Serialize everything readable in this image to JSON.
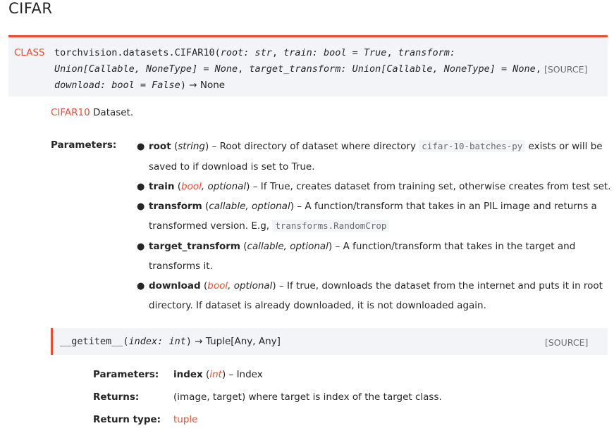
{
  "title": "CIFAR",
  "signature": {
    "class_kw": "CLASS",
    "name": "torchvision.datasets.CIFAR10",
    "open": "(",
    "p1": "root: str",
    "p2": "train: bool = True",
    "p3": "transform:",
    "p3b": "Union[Callable, NoneType] = None",
    "p4": "target_transform: Union[Callable, NoneType] = None",
    "p5": "download: bool = False",
    "close": ")",
    "arrow": "→",
    "ret": "None",
    "source": "[SOURCE]"
  },
  "description": {
    "link": "CIFAR10",
    "text": " Dataset."
  },
  "params_label": "Parameters:",
  "params": [
    {
      "name": "root",
      "type": "string",
      "sep": " – ",
      "desc_a": "Root directory of dataset where directory ",
      "code": "cifar-10-batches-py",
      "desc_b": " exists or will be",
      "cont": "saved to if download is set to True."
    },
    {
      "name": "train",
      "type_link": "bool",
      "type_rest": ", optional",
      "sep": " – ",
      "desc": "If True, creates dataset from training set, otherwise creates from test set."
    },
    {
      "name": "transform",
      "type": "callable, optional",
      "sep": " – ",
      "desc": "A function/transform that takes in an PIL image and returns a",
      "cont_a": "transformed version. E.g, ",
      "code": "transforms.RandomCrop"
    },
    {
      "name": "target_transform",
      "type": "callable, optional",
      "sep": " – ",
      "desc": "A function/transform that takes in the target and",
      "cont": "transforms it."
    },
    {
      "name": "download",
      "type_link": "bool",
      "type_rest": ", optional",
      "sep": " – ",
      "desc": "If true, downloads the dataset from the internet and puts it in root",
      "cont": "directory. If dataset is already downloaded, it is not downloaded again."
    }
  ],
  "method": {
    "name": "__getitem__",
    "open": "(",
    "param": "index: int",
    "close": ")",
    "arrow": "→",
    "ret": "Tuple[Any, Any]",
    "source": "[SOURCE]"
  },
  "method_details": {
    "params_label": "Parameters:",
    "param_name": "index",
    "param_type": "int",
    "param_sep": " – ",
    "param_desc": "Index",
    "returns_label": "Returns:",
    "returns_text": "(image, target) where target is index of the target class.",
    "rtype_label": "Return type:",
    "rtype": "tuple"
  },
  "colors": {
    "accent": "#ee4c2c",
    "code_bg": "#f3f4f7",
    "muted": "#6c6c6d",
    "text": "#262626"
  }
}
